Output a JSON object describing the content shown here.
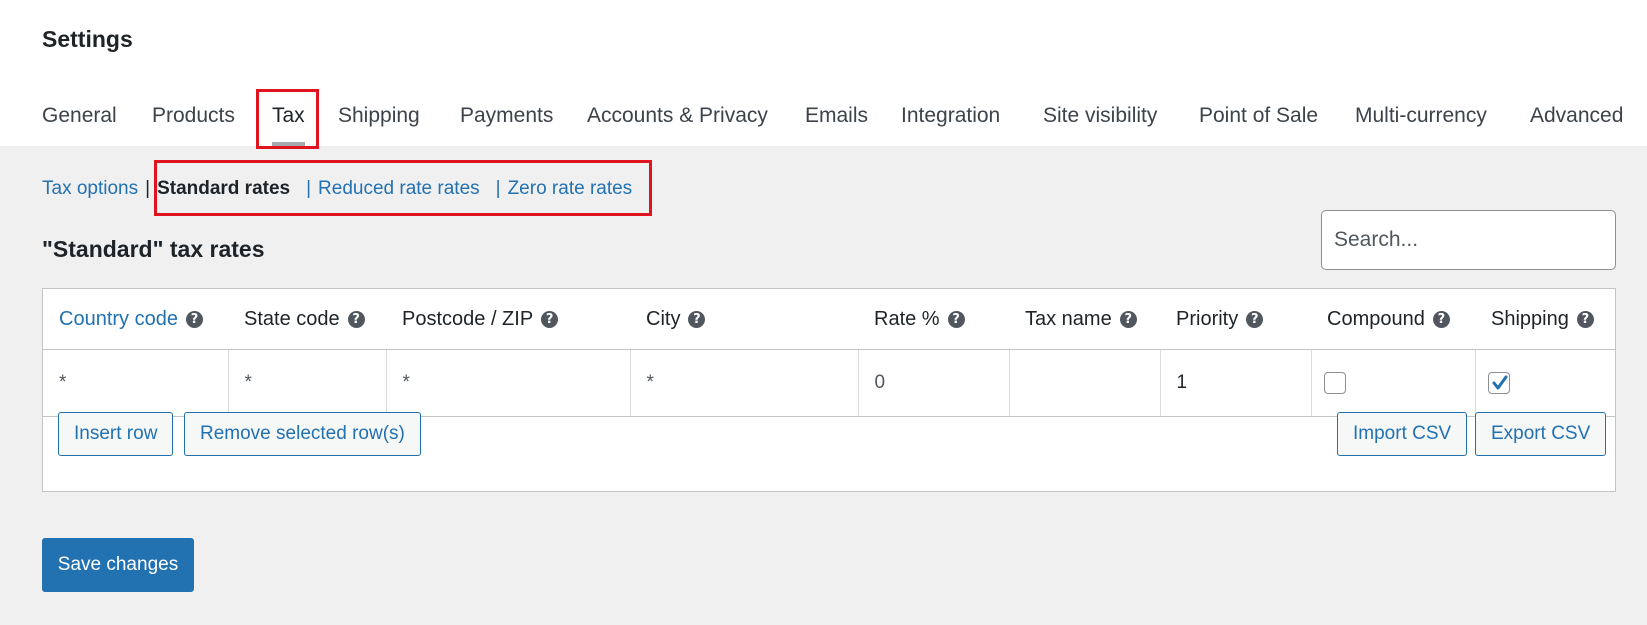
{
  "page": {
    "title": "Settings"
  },
  "main_tabs": [
    {
      "label": "General"
    },
    {
      "label": "Products"
    },
    {
      "label": "Tax"
    },
    {
      "label": "Shipping"
    },
    {
      "label": "Payments"
    },
    {
      "label": "Accounts & Privacy"
    },
    {
      "label": "Emails"
    },
    {
      "label": "Integration"
    },
    {
      "label": "Site visibility"
    },
    {
      "label": "Point of Sale"
    },
    {
      "label": "Multi-currency"
    },
    {
      "label": "Advanced"
    }
  ],
  "active_tab": "Tax",
  "subnav": {
    "items": [
      {
        "label": "Tax options"
      },
      {
        "label": "Standard rates"
      },
      {
        "label": "Reduced rate rates"
      },
      {
        "label": "Zero rate rates"
      }
    ],
    "separator": "|",
    "current": "Standard rates"
  },
  "section": {
    "title": "\"Standard\" tax rates"
  },
  "search": {
    "placeholder": "Search..."
  },
  "table": {
    "headers": [
      {
        "label": "Country code",
        "help": "?"
      },
      {
        "label": "State code",
        "help": "?"
      },
      {
        "label": "Postcode / ZIP",
        "help": "?"
      },
      {
        "label": "City",
        "help": "?"
      },
      {
        "label": "Rate %",
        "help": "?"
      },
      {
        "label": "Tax name",
        "help": "?"
      },
      {
        "label": "Priority",
        "help": "?"
      },
      {
        "label": "Compound",
        "help": "?"
      },
      {
        "label": "Shipping",
        "help": "?"
      }
    ],
    "rows": [
      {
        "country": "*",
        "state": "*",
        "postcode": "*",
        "city": "*",
        "rate": "0",
        "tax_name": "",
        "priority": "1",
        "compound": false,
        "shipping": true
      }
    ]
  },
  "buttons": {
    "insert_row": "Insert row",
    "remove_rows": "Remove selected row(s)",
    "import_csv": "Import CSV",
    "export_csv": "Export CSV",
    "save": "Save changes"
  },
  "colors": {
    "accent": "#2271b1",
    "highlight": "#e0141e",
    "background": "#f0f0f1"
  }
}
